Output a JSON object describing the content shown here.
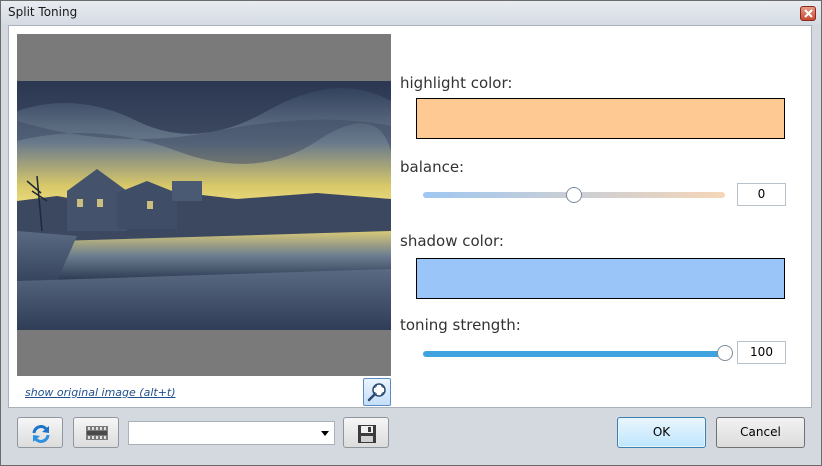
{
  "window": {
    "title": "Split Toning",
    "close_icon": "close-icon"
  },
  "preview": {
    "show_original_link": "show original image (alt+t)",
    "zoom_icon": "zoom-fit-icon"
  },
  "controls": {
    "highlight_label": "highlight color:",
    "highlight_color": "#ffc993",
    "balance_label": "balance:",
    "balance_value": "0",
    "balance_fraction": 0.5,
    "shadow_label": "shadow color:",
    "shadow_color": "#99c5f9",
    "strength_label": "toning strength:",
    "strength_value": "100",
    "strength_fraction": 1.0
  },
  "footer": {
    "reset_icon": "refresh-icon",
    "preset_icon": "film-strip-icon",
    "preset_value": "",
    "save_icon": "save-disk-icon",
    "ok_label": "OK",
    "cancel_label": "Cancel"
  }
}
